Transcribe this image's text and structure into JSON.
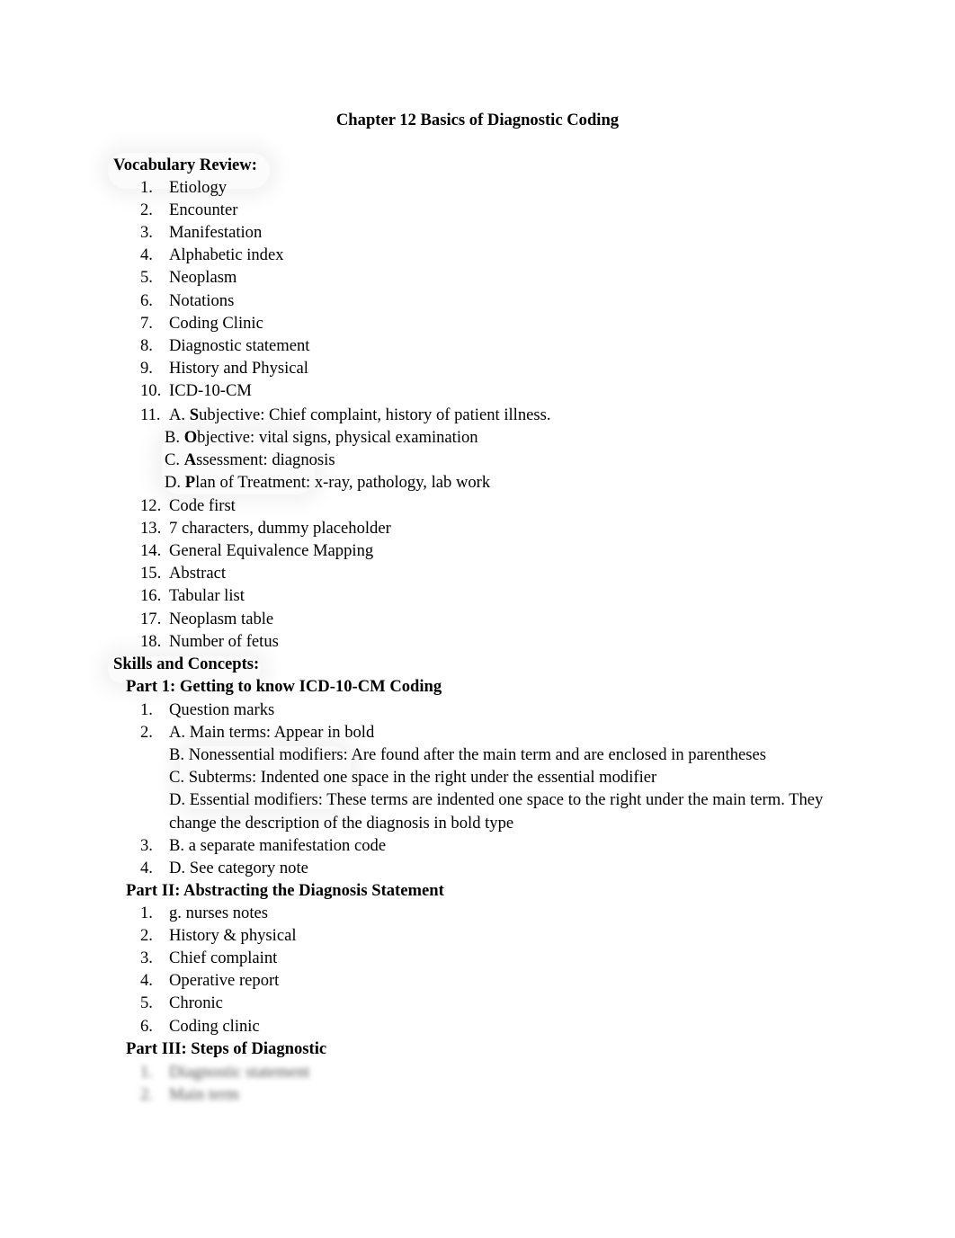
{
  "document": {
    "title": "Chapter 12 Basics of Diagnostic Coding",
    "vocabulary": {
      "heading": "Vocabulary Review:",
      "items": [
        {
          "n": "1.",
          "text": "Etiology"
        },
        {
          "n": "2.",
          "text": "Encounter"
        },
        {
          "n": "3.",
          "text": "Manifestation"
        },
        {
          "n": "4.",
          "text": "Alphabetic index"
        },
        {
          "n": "5.",
          "text": "Neoplasm"
        },
        {
          "n": "6.",
          "text": "Notations"
        },
        {
          "n": "7.",
          "text": "Coding Clinic"
        },
        {
          "n": "8.",
          "text": "Diagnostic statement"
        },
        {
          "n": "9.",
          "text": "History and Physical"
        },
        {
          "n": "10.",
          "text": "ICD-10-CM"
        }
      ],
      "soap": {
        "n": "11.",
        "rows": [
          {
            "prefix": "A. ",
            "bold": "S",
            "rest": "ubjective: Chief complaint, history of patient illness."
          },
          {
            "prefix": "B. ",
            "bold": "O",
            "rest": "bjective: vital signs, physical examination"
          },
          {
            "prefix": "C. ",
            "bold": "A",
            "rest": "ssessment: diagnosis"
          },
          {
            "prefix": "D. ",
            "bold": "P",
            "rest": "lan of Treatment: x-ray, pathology, lab work"
          }
        ]
      },
      "items2": [
        {
          "n": "12.",
          "text": "Code first"
        },
        {
          "n": "13.",
          "text": "7 characters, dummy placeholder"
        },
        {
          "n": "14.",
          "text": "General Equivalence Mapping"
        },
        {
          "n": "15.",
          "text": "Abstract"
        },
        {
          "n": "16.",
          "text": "Tabular list"
        },
        {
          "n": "17.",
          "text": "Neoplasm table"
        },
        {
          "n": "18.",
          "text": "Number of fetus"
        }
      ]
    },
    "skills": {
      "heading": "Skills and Concepts:",
      "part1": {
        "heading": "Part 1: Getting to know ICD-10-CM Coding",
        "items": [
          {
            "n": "1.",
            "text": "Question marks"
          },
          {
            "n": "2.",
            "text": "A. Main terms: Appear in bold"
          },
          {
            "n": "",
            "text": "B. Nonessential modifiers: Are found after the main term and are enclosed in parentheses"
          },
          {
            "n": "",
            "text": "C. Subterms: Indented one space in the right under the essential modifier"
          },
          {
            "n": "",
            "text": "D. Essential modifiers: These terms are indented one space to the right under the main term. They"
          },
          {
            "n": "",
            "text": "change the description of the diagnosis in bold type"
          },
          {
            "n": "3.",
            "text": "B. a separate manifestation code"
          },
          {
            "n": "4.",
            "text": "D. See category note"
          }
        ]
      },
      "part2": {
        "heading": "Part II: Abstracting the Diagnosis Statement",
        "items": [
          {
            "n": "1.",
            "text": "g. nurses notes"
          },
          {
            "n": "2.",
            "text": "History & physical"
          },
          {
            "n": "3.",
            "text": "Chief complaint"
          },
          {
            "n": "4.",
            "text": "Operative report"
          },
          {
            "n": "5.",
            "text": "Chronic"
          },
          {
            "n": "6.",
            "text": "Coding clinic"
          }
        ]
      },
      "part3": {
        "heading": "Part III: Steps of Diagnostic",
        "items": [
          {
            "n": "1.",
            "text": "Diagnostic statement"
          },
          {
            "n": "2.",
            "text": "Main term"
          }
        ]
      }
    }
  }
}
